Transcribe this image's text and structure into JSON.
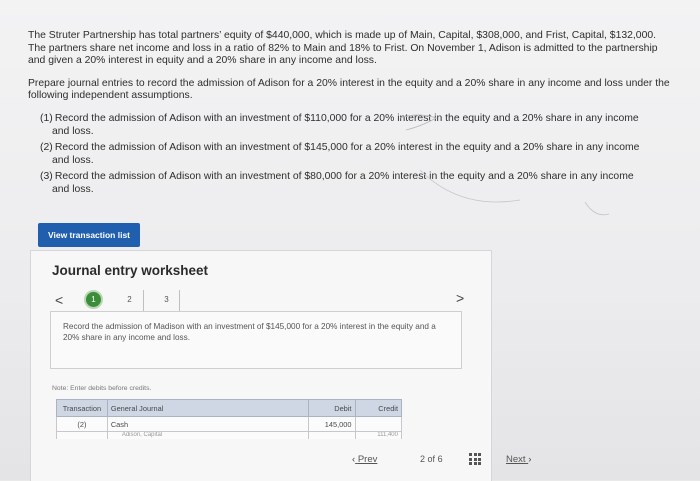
{
  "problem": {
    "intro": "The Struter Partnership has total partners’ equity of $440,000, which is made up of Main, Capital, $308,000, and Frist, Capital, $132,000. The partners share net income and loss in a ratio of 82% to Main and 18% to Frist. On November 1, Adison is admitted to the partnership and given a 20% interest in equity and a 20% share in any income and loss.",
    "prompt": "Prepare journal entries to record the admission of Adison for a 20% interest in the equity and a 20% share in any income and loss under the following independent assumptions.",
    "items": [
      {
        "num": "(1)",
        "text": "Record the admission of Adison with an investment of $110,000 for a 20% interest in the equity and a 20% share in any income",
        "cont": "and loss."
      },
      {
        "num": "(2)",
        "text": "Record the admission of Adison with an investment of $145,000 for a 20% interest in the equity and a 20% share in any income",
        "cont": "and loss."
      },
      {
        "num": "(3)",
        "text": "Record the admission of Adison with an investment of $80,000 for a 20% interest in the equity and a 20% share in any income",
        "cont": "and loss."
      }
    ]
  },
  "buttons": {
    "view_transaction_list": "View transaction list"
  },
  "worksheet": {
    "title": "Journal entry worksheet",
    "nav_prev": "<",
    "nav_next": ">",
    "steps": [
      "1",
      "2",
      "3"
    ],
    "instruction": "Record the admission of Madison with an investment of $145,000 for a 20% interest in the equity and a 20% share in any income and loss.",
    "note": "Note: Enter debits before credits.",
    "table": {
      "headers": {
        "transaction": "Transaction",
        "general_journal": "General Journal",
        "debit": "Debit",
        "credit": "Credit"
      },
      "rows": [
        {
          "transaction": "(2)",
          "account": "Cash",
          "debit": "145,000",
          "credit": ""
        },
        {
          "transaction": "",
          "account": "Adison, Capital",
          "debit": "",
          "credit": "111,400"
        }
      ]
    }
  },
  "pagination": {
    "prev_label": "Prev",
    "current": "2",
    "of_label": "of",
    "total": "6",
    "next_label": "Next"
  },
  "colors": {
    "button_blue": "#1f5fae",
    "step_active_green": "#3b8c3b",
    "table_header": "#cfd7e4"
  }
}
